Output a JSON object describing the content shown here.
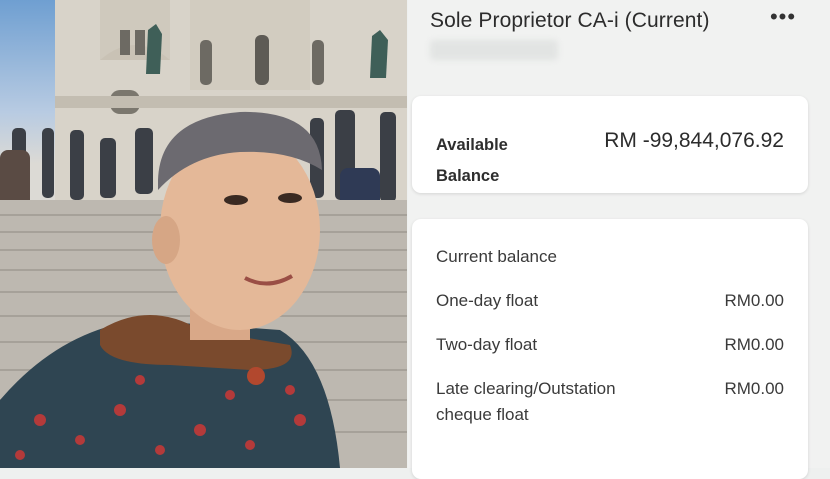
{
  "account": {
    "title": "Sole Proprietor CA-i (Current)"
  },
  "available": {
    "label": "Available Balance",
    "value": "RM -99,844,076.92"
  },
  "balance_card": {
    "heading": "Current balance",
    "rows": [
      {
        "label": "One-day float",
        "value": "RM0.00"
      },
      {
        "label": "Two-day float",
        "value": "RM0.00"
      },
      {
        "label": "Late clearing/Outstation cheque float",
        "value": "RM0.00"
      }
    ]
  },
  "colors": {
    "sky": "#6f9fd1",
    "stone": "#cfcac2",
    "card": "#ffffff",
    "panel": "#f1f2f1",
    "text": "#2c2c2c"
  },
  "icons": {
    "menu": "more-horizontal-icon"
  }
}
